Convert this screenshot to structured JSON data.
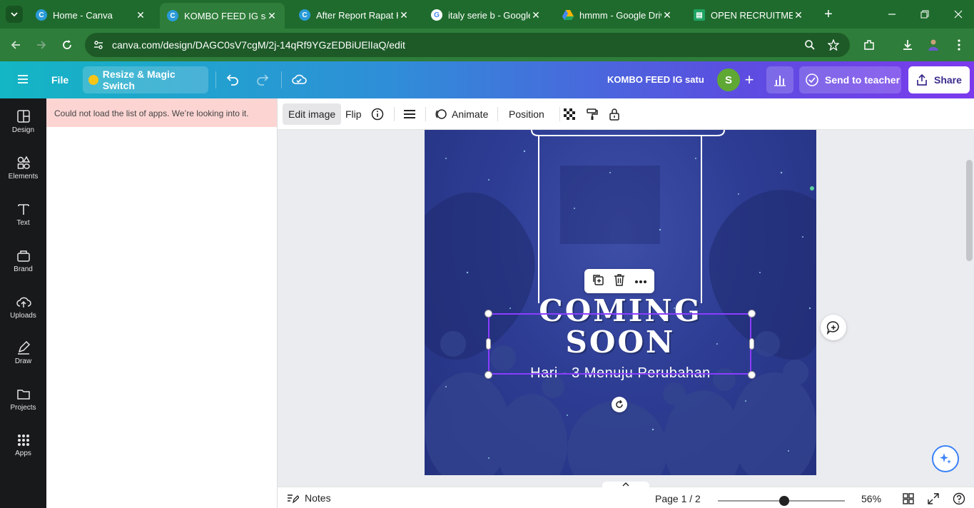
{
  "browser": {
    "tabs": [
      {
        "title": "Home - Canva",
        "favicon": "canva-icon",
        "color": "#2a9bd8"
      },
      {
        "title": "KOMBO FEED IG satu",
        "favicon": "canva-icon",
        "color": "#2a9bd8"
      },
      {
        "title": "After Report Rapat K",
        "favicon": "canva-icon",
        "color": "#2a9bd8"
      },
      {
        "title": "italy serie b - Google",
        "favicon": "google-icon",
        "color": "#ffffff"
      },
      {
        "title": "hmmm - Google Drive",
        "favicon": "drive-icon",
        "color": "#f7b500"
      },
      {
        "title": "OPEN RECRUITMENT",
        "favicon": "sheets-icon",
        "color": "#1fa463"
      }
    ],
    "url": "canva.com/design/DAGC0sV7cgM/2j-14qRf9YGzEDBiUElIaQ/edit"
  },
  "header": {
    "file_label": "File",
    "resize_label": "Resize & Magic Switch",
    "doc_title": "KOMBO FEED IG satu",
    "avatar_initial": "S",
    "teacher_label": "Send to teacher",
    "share_label": "Share"
  },
  "sidebar": {
    "items": [
      {
        "label": "Design",
        "icon": "design-icon"
      },
      {
        "label": "Elements",
        "icon": "elements-icon"
      },
      {
        "label": "Text",
        "icon": "text-icon"
      },
      {
        "label": "Brand",
        "icon": "brand-icon"
      },
      {
        "label": "Uploads",
        "icon": "uploads-icon"
      },
      {
        "label": "Draw",
        "icon": "draw-icon"
      },
      {
        "label": "Projects",
        "icon": "projects-icon"
      },
      {
        "label": "Apps",
        "icon": "apps-icon"
      }
    ]
  },
  "panel": {
    "error_message": "Could not load the list of apps. We’re looking into it."
  },
  "toolbar": {
    "edit_image": "Edit image",
    "flip": "Flip",
    "animate": "Animate",
    "position": "Position"
  },
  "design": {
    "headline_line1": "COMING",
    "headline_line2": "SOON",
    "subtitle": "Hari - 3 Menuju Perubahan"
  },
  "footer": {
    "notes_label": "Notes",
    "page_indicator": "Page 1 / 2",
    "zoom_value": "56%",
    "zoom_fraction": 0.56
  },
  "colors": {
    "header_gradient_start": "#13b6c4",
    "header_gradient_end": "#7c3aed",
    "selection": "#8b3dff",
    "browser_green": "#2e7d3a"
  }
}
